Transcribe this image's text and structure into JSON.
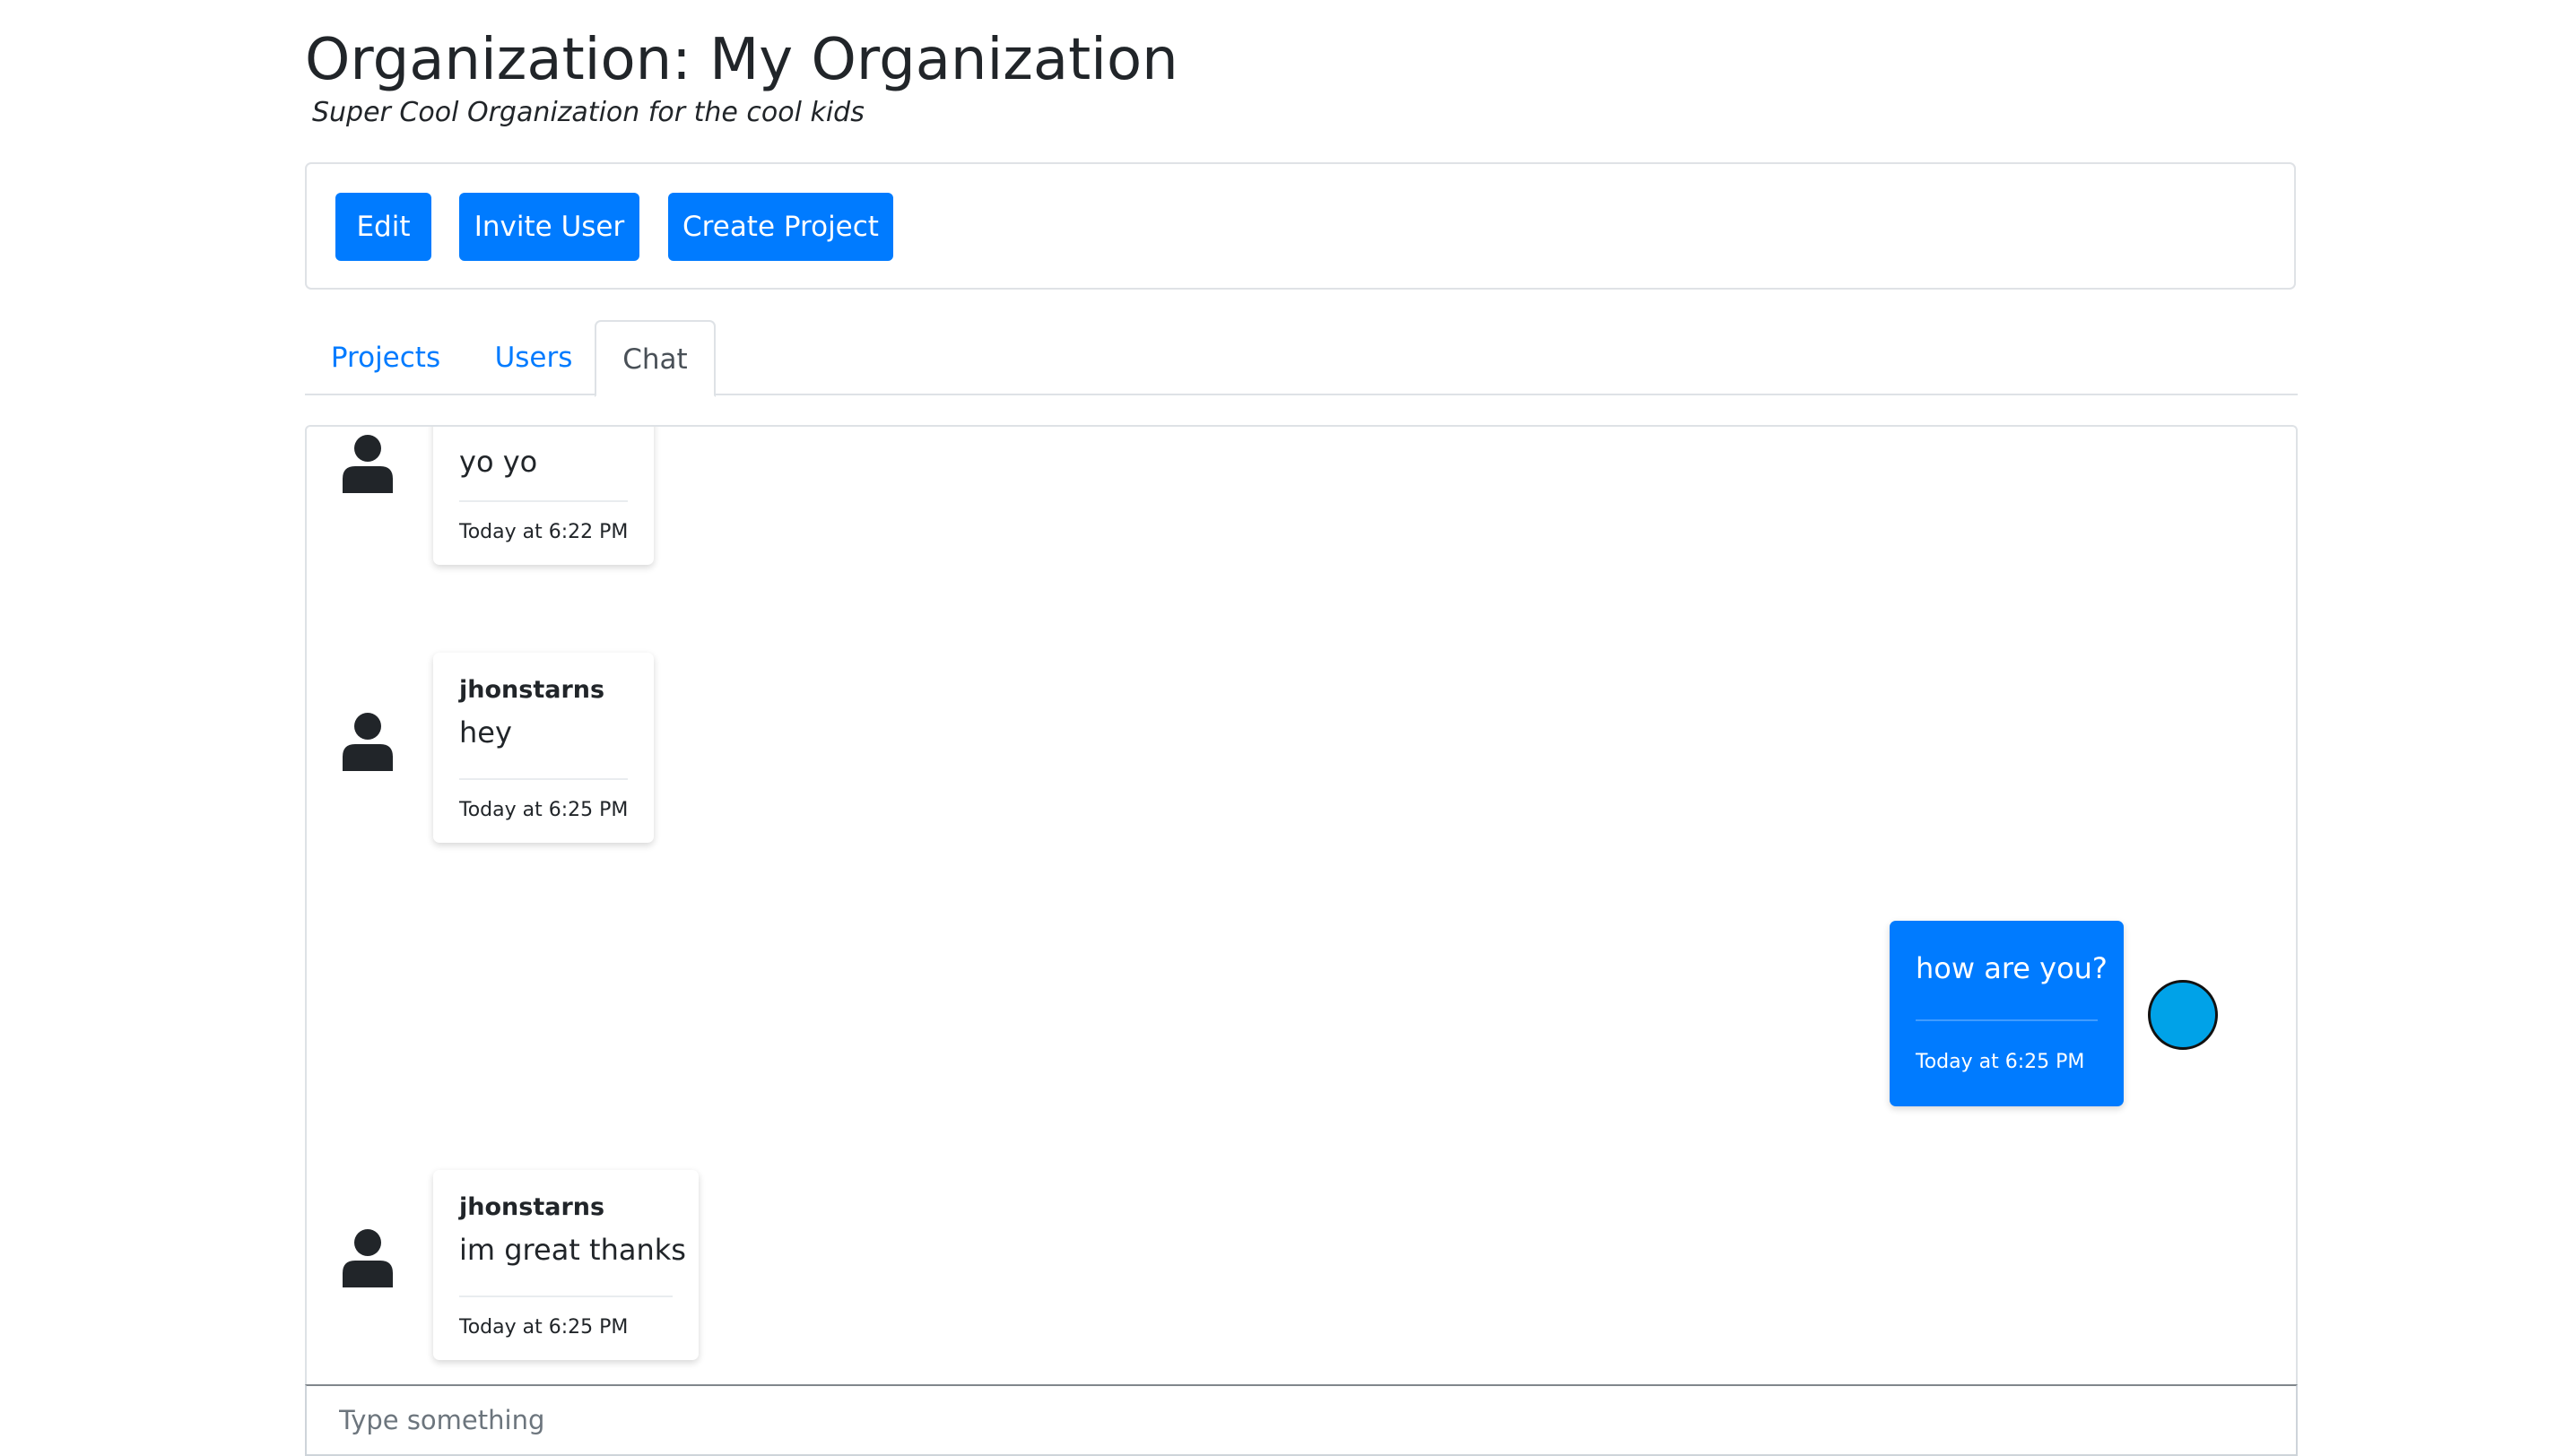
{
  "organization": {
    "title": "Organization: My Organization",
    "subtitle": "Super Cool Organization for the cool kids"
  },
  "toolbar": {
    "edit_label": "Edit",
    "invite_label": "Invite User",
    "create_project_label": "Create Project"
  },
  "tabs": [
    {
      "label": "Projects",
      "active": false
    },
    {
      "label": "Users",
      "active": false
    },
    {
      "label": "Chat",
      "active": true
    }
  ],
  "messages": [
    {
      "author": "",
      "text": "yo yo",
      "time": "Today at 6:22 PM",
      "outgoing": false
    },
    {
      "author": "jhonstarns",
      "text": "hey",
      "time": "Today at 6:25 PM",
      "outgoing": false
    },
    {
      "author": "",
      "text": "how are you?",
      "time": "Today at 6:25 PM",
      "outgoing": true
    },
    {
      "author": "jhonstarns",
      "text": "im great thanks",
      "time": "Today at 6:25 PM",
      "outgoing": false
    }
  ],
  "chat_input": {
    "placeholder": "Type something",
    "value": ""
  },
  "colors": {
    "primary": "#007bff",
    "self_avatar": "#00a2e8"
  },
  "icons": {
    "user_avatar": "user-silhouette-icon",
    "self_avatar": "circle-avatar-icon"
  }
}
